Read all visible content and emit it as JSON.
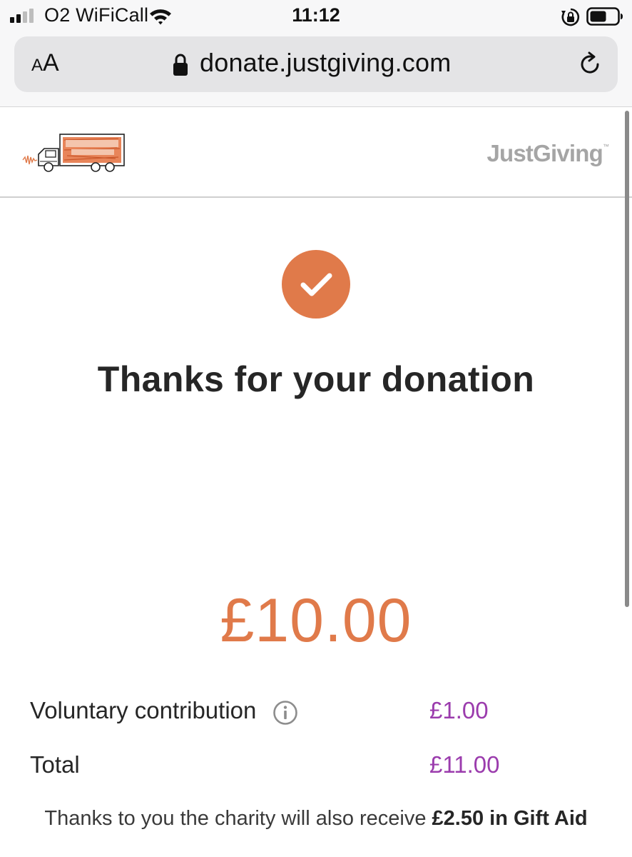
{
  "status_bar": {
    "carrier": "O2 WiFiCall",
    "time": "11:12"
  },
  "browser": {
    "text_size_label_small": "A",
    "text_size_label_large": "A",
    "url": "donate.justgiving.com"
  },
  "header": {
    "platform_logo": "JustGiving",
    "trademark": "™"
  },
  "confirmation": {
    "heading": "Thanks for your donation",
    "amount": "£10.00"
  },
  "summary": {
    "contribution_label": "Voluntary contribution",
    "contribution_value": "£1.00",
    "total_label": "Total",
    "total_value": "£11.00"
  },
  "gift_aid": {
    "prefix": "Thanks to you the charity will also receive ",
    "amount_text": "£2.50 in Gift Aid"
  },
  "colors": {
    "accent": "#e07a4a",
    "value_purple": "#9b3cad",
    "logo_grey": "#a5a5a5"
  },
  "icons": [
    "signal-icon",
    "wifi-icon",
    "rotation-lock-icon",
    "battery-icon",
    "lock-icon",
    "reload-icon",
    "checkmark-icon",
    "info-icon"
  ]
}
